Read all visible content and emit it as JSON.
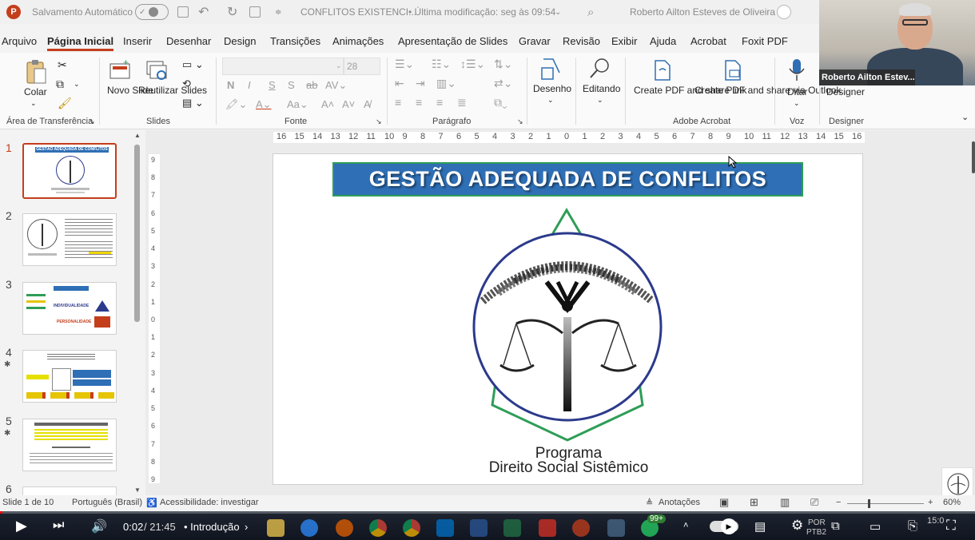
{
  "titlebar": {
    "app_icon": "P",
    "autosave_label": "Salvamento Automático",
    "doc_title": "CONFLITOS EXISTENCI...",
    "modified": "• Última modificação: seg às 09:54",
    "user_name": "Roberto Ailton Esteves de Oliveira"
  },
  "menu": {
    "tabs": [
      "Arquivo",
      "Página Inicial",
      "Inserir",
      "Desenhar",
      "Design",
      "Transições",
      "Animações",
      "Apresentação de Slides",
      "Gravar",
      "Revisão",
      "Exibir",
      "Ajuda",
      "Acrobat",
      "Foxit PDF"
    ],
    "active": "Página Inicial"
  },
  "ribbon": {
    "paste": "Colar",
    "clipboard_group": "Área de Transferência",
    "new_slide": "Novo Slide",
    "reuse_slides": "Reutilizar Slides",
    "slides_group": "Slides",
    "font_size": "28",
    "font_group": "Fonte",
    "paragraph_group": "Parágrafo",
    "drawing": "Desenho",
    "editing": "Editando",
    "create_pdf_link": "Create PDF and share link",
    "create_pdf_outlook": "Create PDF and share via Outlook",
    "acrobat_group": "Adobe Acrobat",
    "dictate": "Ditar",
    "voice_group": "Voz",
    "designer": "Designer",
    "designer_group": "Designer"
  },
  "webcam": {
    "name": "Roberto Ailton Estev..."
  },
  "thumbnails": [
    {
      "num": "1",
      "star": false,
      "active": true
    },
    {
      "num": "2",
      "star": false,
      "active": false
    },
    {
      "num": "3",
      "star": false,
      "active": false
    },
    {
      "num": "4",
      "star": true,
      "active": false
    },
    {
      "num": "5",
      "star": true,
      "active": false
    },
    {
      "num": "6",
      "star": false,
      "active": false
    }
  ],
  "thumb_texts": {
    "t1_title": "GESTÃO ADEQUADA DE CONFLITOS",
    "t3_individualidade": "INDIVIDUALIDADE",
    "t3_personalidade": "PERSONALIDADE"
  },
  "ruler": {
    "h_labels": [
      "16",
      "15",
      "14",
      "13",
      "12",
      "11",
      "10",
      "9",
      "8",
      "7",
      "6",
      "5",
      "4",
      "3",
      "2",
      "1",
      "0",
      "1",
      "2",
      "3",
      "4",
      "5",
      "6",
      "7",
      "8",
      "9",
      "10",
      "11",
      "12",
      "13",
      "14",
      "15",
      "16"
    ],
    "v_labels": [
      "9",
      "8",
      "7",
      "6",
      "5",
      "4",
      "3",
      "2",
      "1",
      "0",
      "1",
      "2",
      "3",
      "4",
      "5",
      "6",
      "7",
      "8",
      "9"
    ]
  },
  "slide": {
    "title": "GESTÃO ADEQUADA DE CONFLITOS",
    "program": "Programa",
    "program_name": "Direito Social Sistêmico"
  },
  "statusbar": {
    "slide_pos": "Slide 1 de 10",
    "language": "Português (Brasil)",
    "accessibility": "Acessibilidade: investigar",
    "notes": "Anotações",
    "zoom": "60%"
  },
  "video": {
    "time_current": "0:02",
    "time_total": "/ 21:45",
    "chapter": "• Introdução",
    "notif_badge": "99+",
    "lang": "POR",
    "lang2": "PTB2",
    "clock": "15:0",
    "progress": 0.002,
    "colors": {
      "progress": "#ff0000"
    }
  },
  "colors": {
    "accent": "#c43e1c",
    "banner": "#2f6fb5",
    "banner_border": "#2e9d57"
  }
}
